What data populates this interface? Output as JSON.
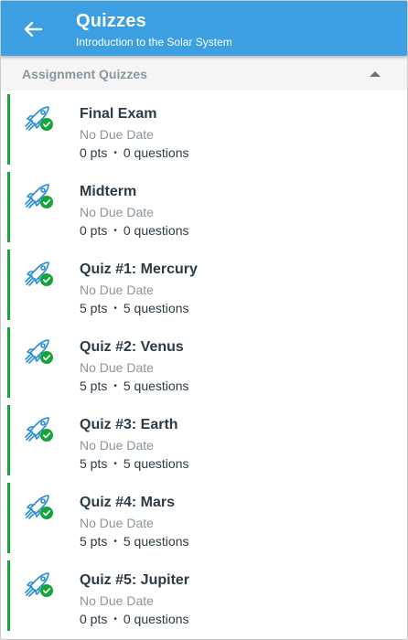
{
  "header": {
    "title": "Quizzes",
    "subtitle": "Introduction to the Solar System",
    "back_icon": "arrow-left-icon",
    "color": "#3c9fe2"
  },
  "section": {
    "title": "Assignment Quizzes",
    "collapse_icon": "caret-up-icon"
  },
  "quiz_icon": "rocket-quiz-published-icon",
  "status_color": "#13a538",
  "quizzes": [
    {
      "title": "Final Exam",
      "due": "No Due Date",
      "points": "0 pts",
      "separator": "•",
      "questions": "0 questions"
    },
    {
      "title": "Midterm",
      "due": "No Due Date",
      "points": "0 pts",
      "separator": "•",
      "questions": "0 questions"
    },
    {
      "title": "Quiz #1: Mercury",
      "due": "No Due Date",
      "points": "5 pts",
      "separator": "•",
      "questions": "5 questions"
    },
    {
      "title": "Quiz #2: Venus",
      "due": "No Due Date",
      "points": "5 pts",
      "separator": "•",
      "questions": "5 questions"
    },
    {
      "title": "Quiz #3: Earth",
      "due": "No Due Date",
      "points": "5 pts",
      "separator": "•",
      "questions": "5 questions"
    },
    {
      "title": "Quiz #4: Mars",
      "due": "No Due Date",
      "points": "5 pts",
      "separator": "•",
      "questions": "5 questions"
    },
    {
      "title": "Quiz #5: Jupiter",
      "due": "No Due Date",
      "points": "0 pts",
      "separator": "•",
      "questions": "0 questions"
    }
  ]
}
